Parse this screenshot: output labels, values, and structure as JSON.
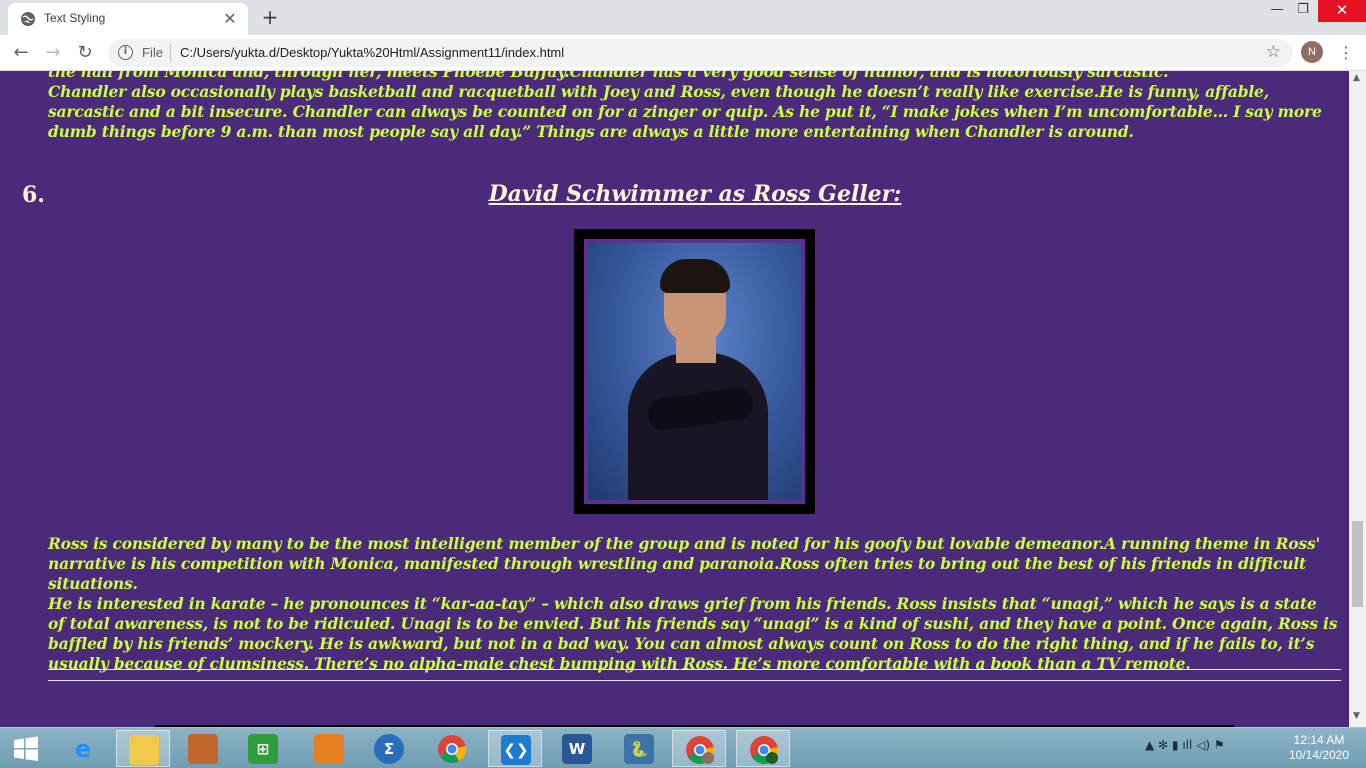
{
  "tab": {
    "title": "Text Styling",
    "close": "✕",
    "new_tab": "+"
  },
  "window_controls": {
    "minimize": "—",
    "maximize": "❐",
    "close": "✕"
  },
  "toolbar": {
    "back": "←",
    "forward": "→",
    "reload": "↻",
    "scheme": "File",
    "url": "C:/Users/yukta.d/Desktop/Yukta%20Html/Assignment11/index.html",
    "star": "☆",
    "avatar": "N",
    "menu": "⋮"
  },
  "page": {
    "para_top": [
      "the hall from Monica and, through her, meets Phoebe Buffay.Chandler has a very good sense of humor, and is notoriously sarcastic.",
      "Chandler also occasionally plays basketball and racquetball with Joey and Ross, even though he doesn’t really like exercise.He is funny, affable, sarcastic and a bit insecure. Chandler can always be counted on for a zinger or quip. As he put it, “I make jokes when I’m uncomfortable… I say more dumb things before 9 a.m. than most people say all day.” Things are always a little more entertaining when Chandler is around."
    ],
    "item_number": "6.",
    "heading": "David Schwimmer as Ross Geller:",
    "para_bottom": [
      "Ross is considered by many to be the most intelligent member of the group and is noted for his goofy but lovable demeanor.A running theme in Ross' narrative is his competition with Monica, manifested through wrestling and paranoia.Ross often tries to bring out the best of his friends in difficult situations.",
      "He is interested in karate – he pronounces it “kar-aa-tay” – which also draws grief from his friends. Ross insists that “unagi,” which he says is a state of total awareness, is not to be ridiculed. Unagi is to be envied. But his friends say “unagi” is a kind of sushi, and they have a point. Once again, Ross is baffled by his friends’ mockery. He is awkward, but not in a bad way. You can almost always count on Ross to do the right thing, and if he fails to, it’s usually because of clumsiness. There’s no alpha-male chest bumping with Ross. He’s more comfortable with a book than a TV remote."
    ],
    "colors": {
      "background": "#4b2a7b",
      "body_text": "#c9ff40",
      "heading_text": "#fff4d6"
    }
  },
  "taskbar": {
    "icons": [
      "ie-icon",
      "file-explorer-icon",
      "media-icon",
      "store-icon",
      "office-icon",
      "math-icon",
      "chrome-icon",
      "vscode-icon",
      "word-icon",
      "python-icon",
      "chrome-n-icon",
      "chrome-y-icon"
    ],
    "tray_text": "▲ ✻ ▮ ıll ◁) ⚑",
    "time": "12:14 AM",
    "date": "10/14/2020"
  }
}
